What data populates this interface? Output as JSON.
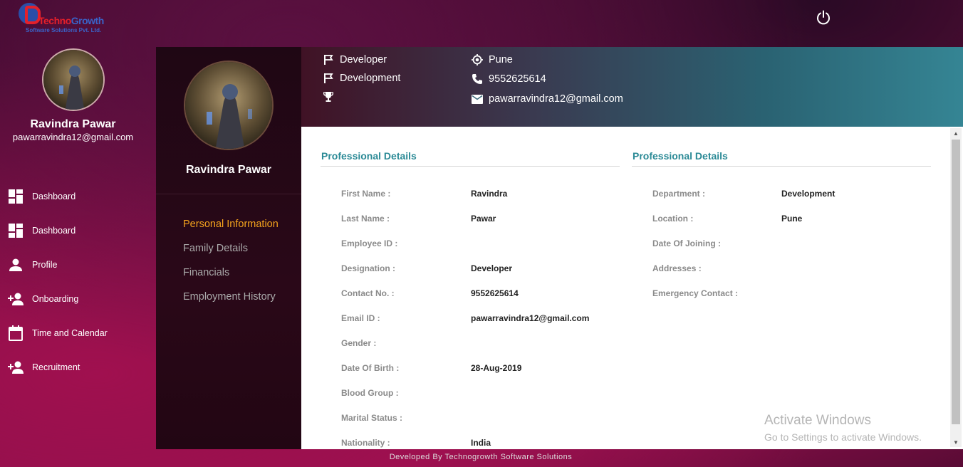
{
  "logo": {
    "brand_part1": "Techno",
    "brand_part2": "Growth",
    "tagline": "Software Solutions Pvt. Ltd."
  },
  "user": {
    "name": "Ravindra Pawar",
    "email": "pawarravindra12@gmail.com"
  },
  "nav": [
    {
      "label": "Dashboard",
      "icon": "dashboard-icon"
    },
    {
      "label": "Dashboard",
      "icon": "dashboard-icon"
    },
    {
      "label": "Profile",
      "icon": "person-icon"
    },
    {
      "label": "Onboarding",
      "icon": "person-add-icon"
    },
    {
      "label": "Time and Calendar",
      "icon": "calendar-icon"
    },
    {
      "label": "Recruitment",
      "icon": "person-add-icon"
    }
  ],
  "profile_menu": [
    "Personal Information",
    "Family Details",
    "Financials",
    "Employment History"
  ],
  "header": {
    "designation": "Developer",
    "department": "Development",
    "location": "Pune",
    "phone": "9552625614",
    "email": "pawarravindra12@gmail.com"
  },
  "sections": {
    "left_title": "Professional Details",
    "right_title": "Professional Details"
  },
  "left_fields": [
    {
      "label": "First Name :",
      "value": "Ravindra"
    },
    {
      "label": "Last Name :",
      "value": "Pawar"
    },
    {
      "label": "Employee ID :",
      "value": ""
    },
    {
      "label": "Designation :",
      "value": "Developer"
    },
    {
      "label": "Contact No. :",
      "value": "9552625614"
    },
    {
      "label": "Email ID :",
      "value": "pawarravindra12@gmail.com"
    },
    {
      "label": "Gender :",
      "value": ""
    },
    {
      "label": "Date Of Birth :",
      "value": "28-Aug-2019"
    },
    {
      "label": "Blood Group :",
      "value": ""
    },
    {
      "label": "Marital Status :",
      "value": ""
    },
    {
      "label": "Nationality :",
      "value": "India"
    }
  ],
  "right_fields": [
    {
      "label": "Department :",
      "value": "Development"
    },
    {
      "label": "Location :",
      "value": "Pune"
    },
    {
      "label": "Date Of Joining :",
      "value": ""
    },
    {
      "label": "Addresses :",
      "value": ""
    },
    {
      "label": "Emergency Contact :",
      "value": ""
    }
  ],
  "watermark": {
    "line1": "Activate Windows",
    "line2": "Go to Settings to activate Windows."
  },
  "footer": "Developed By Technogrowth Software Solutions",
  "colors": {
    "accent": "#2b8a96",
    "active_menu": "#f4a31d"
  }
}
